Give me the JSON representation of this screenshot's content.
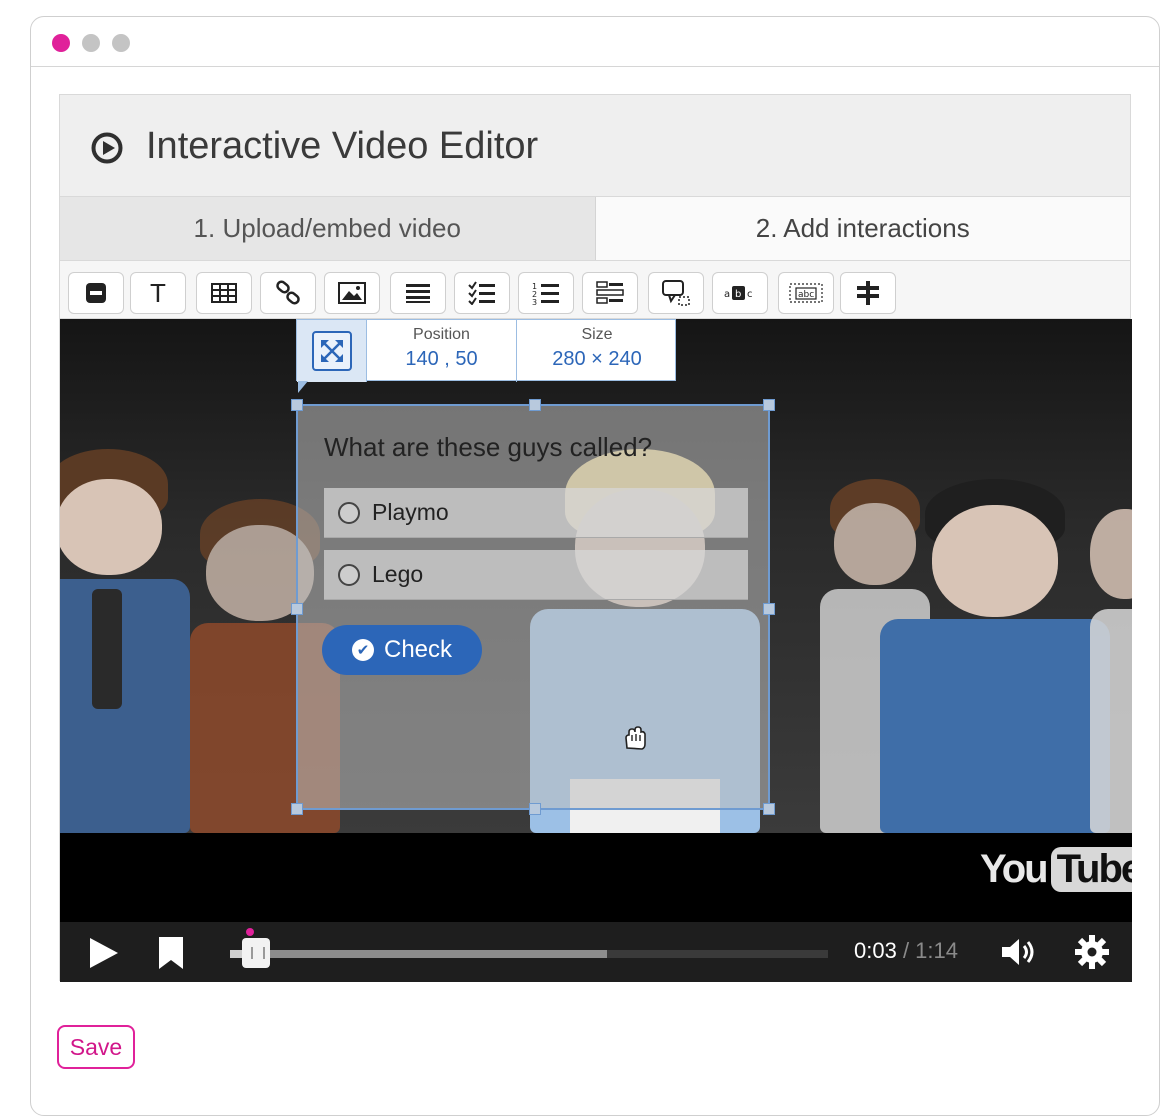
{
  "window": {
    "dot_colors": [
      "#e0219a",
      "#c4c4c4",
      "#c4c4c4"
    ]
  },
  "editor": {
    "title": "Interactive Video Editor",
    "tabs": [
      {
        "label": "1. Upload/embed video",
        "active": false
      },
      {
        "label": "2. Add interactions",
        "active": true
      }
    ],
    "toolbar": [
      {
        "icon": "statement-icon"
      },
      {
        "icon": "text-icon",
        "glyph": "T"
      },
      {
        "icon": "table-icon"
      },
      {
        "icon": "link-icon"
      },
      {
        "icon": "image-icon"
      },
      {
        "icon": "list-icon"
      },
      {
        "icon": "checklist-icon"
      },
      {
        "icon": "numbered-list-icon"
      },
      {
        "icon": "form-icon"
      },
      {
        "icon": "speech-bubble-icon"
      },
      {
        "icon": "mark-words-icon",
        "glyph": "abc"
      },
      {
        "icon": "fill-blanks-icon",
        "glyph": "abc"
      },
      {
        "icon": "crossroads-icon"
      }
    ]
  },
  "interaction": {
    "position_label": "Position",
    "position_value": "140 , 50",
    "size_label": "Size",
    "size_value": "280 × 240",
    "question": "What are these guys called?",
    "options": [
      "Playmo",
      "Lego"
    ],
    "check_label": "Check"
  },
  "player": {
    "logo_you": "You",
    "logo_tube": "Tube",
    "current_time": "0:03",
    "separator": " / ",
    "duration": "1:14",
    "played_fraction": 0.04,
    "buffered_fraction": 0.63
  },
  "save_label": "Save",
  "colors": {
    "accent": "#e0219a",
    "brand_blue": "#2c66b8"
  }
}
